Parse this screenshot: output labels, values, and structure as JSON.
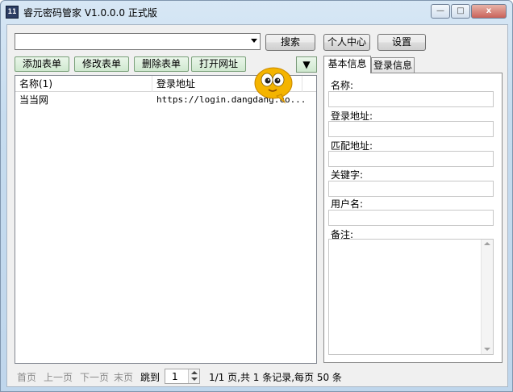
{
  "window": {
    "title": "睿元密码管家 V1.0.0.0 正式版",
    "app_icon_text": "11",
    "min_glyph": "—",
    "max_glyph": "□",
    "close_glyph": "x"
  },
  "toolbar": {
    "search_value": "",
    "search_label": "搜索",
    "user_center_label": "个人中心",
    "settings_label": "设置"
  },
  "actions": {
    "add_label": "添加表单",
    "edit_label": "修改表单",
    "delete_label": "删除表单",
    "open_label": "打开网址",
    "dropdown_glyph": "▼"
  },
  "list": {
    "columns": [
      "名称(1)",
      "登录地址"
    ],
    "rows": [
      {
        "name": "当当网",
        "url": "https://login.dangdang.co..."
      }
    ]
  },
  "tabs": [
    "基本信息",
    "登录信息"
  ],
  "form": {
    "fields": [
      "名称:",
      "登录地址:",
      "匹配地址:",
      "关键字:",
      "用户名:"
    ],
    "memo_label": "备注:"
  },
  "pager": {
    "first": "首页",
    "prev": "上一页",
    "next": "下一页",
    "last": "末页",
    "goto": "跳到",
    "page_value": "1",
    "summary": "1/1 页,共 1 条记录,每页 50 条"
  },
  "colors": {
    "titlebar": "#c6dcef",
    "green_button": "#cfe8cf",
    "close_button": "#c9625a"
  }
}
